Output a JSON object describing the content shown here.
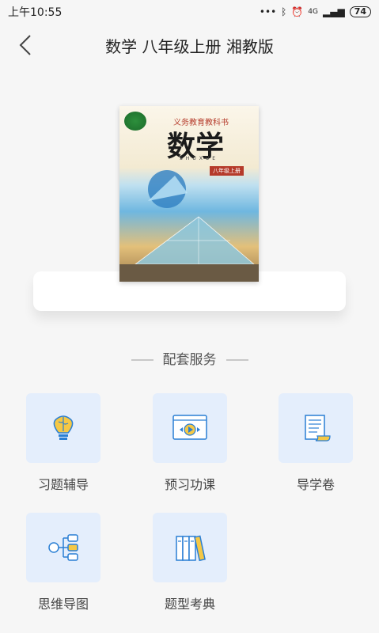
{
  "status_bar": {
    "time": "上午10:55",
    "signal": "4G",
    "battery": "74"
  },
  "header": {
    "title": "数学 八年级上册 湘教版"
  },
  "cover": {
    "series": "义务教育教科书",
    "subject": "数学",
    "pinyin": "SHUXUE",
    "grade": "八年级上册"
  },
  "section": {
    "title": "配套服务"
  },
  "services": [
    {
      "label": "习题辅导",
      "icon": "brain-bulb-icon"
    },
    {
      "label": "预习功课",
      "icon": "video-player-icon"
    },
    {
      "label": "导学卷",
      "icon": "scroll-doc-icon"
    },
    {
      "label": "思维导图",
      "icon": "mind-map-icon"
    },
    {
      "label": "题型考典",
      "icon": "books-icon"
    }
  ],
  "colors": {
    "accent_blue": "#2a7fd4",
    "accent_yellow": "#f5c845",
    "tile_bg": "#e4eefc"
  }
}
